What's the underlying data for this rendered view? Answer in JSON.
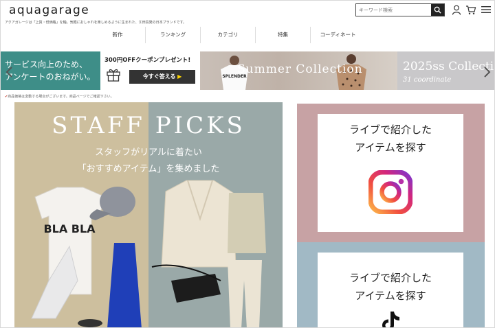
{
  "header": {
    "logo": "aquagarage",
    "tagline": "アクアガレージは「上質・低価格」を軸。気軽におしゃれを楽しめるように生まれた、江田島発の日本ブランドです。",
    "search_placeholder": "キーワード検索"
  },
  "nav": [
    "新作",
    "ランキング",
    "カテゴリ",
    "特集",
    "コーディネート"
  ],
  "banners": {
    "survey": {
      "line1": "サービス向上のため、",
      "line2": "アンケートのおねがい。"
    },
    "coupon": {
      "title": "300円OFFクーポンプレゼント!",
      "cta": "今すぐ答える",
      "cta_arrow": "▶"
    },
    "summer": {
      "title": "Summer Collection",
      "shirt_text": "SPLENDER"
    },
    "collection": {
      "title": "2025ss Collecti",
      "subtitle": "31 coordinate"
    }
  },
  "notice": "商品価格は変動する場合がございます。商品ページでご確認下さい。",
  "notice_mark": "✔",
  "staff_picks": {
    "title": "STAFF PICKS",
    "sub1": "スタッフがリアルに着たい",
    "sub2": "「おすすめアイテム」を集めました",
    "shirt_text": "BLA BLA"
  },
  "panels": [
    {
      "line1": "ライブで紹介した",
      "line2": "アイテムを探す",
      "icon": "instagram-icon"
    },
    {
      "line1": "ライブで紹介した",
      "line2": "アイテムを探す",
      "icon": "tiktok-icon"
    }
  ],
  "colors": {
    "survey_bg": "#3e8e88",
    "staff_left": "#cdbf9e",
    "staff_right": "#9aa9a8",
    "panel_instagram": "#c7a2a4",
    "panel_tiktok": "#a1b9c5"
  }
}
